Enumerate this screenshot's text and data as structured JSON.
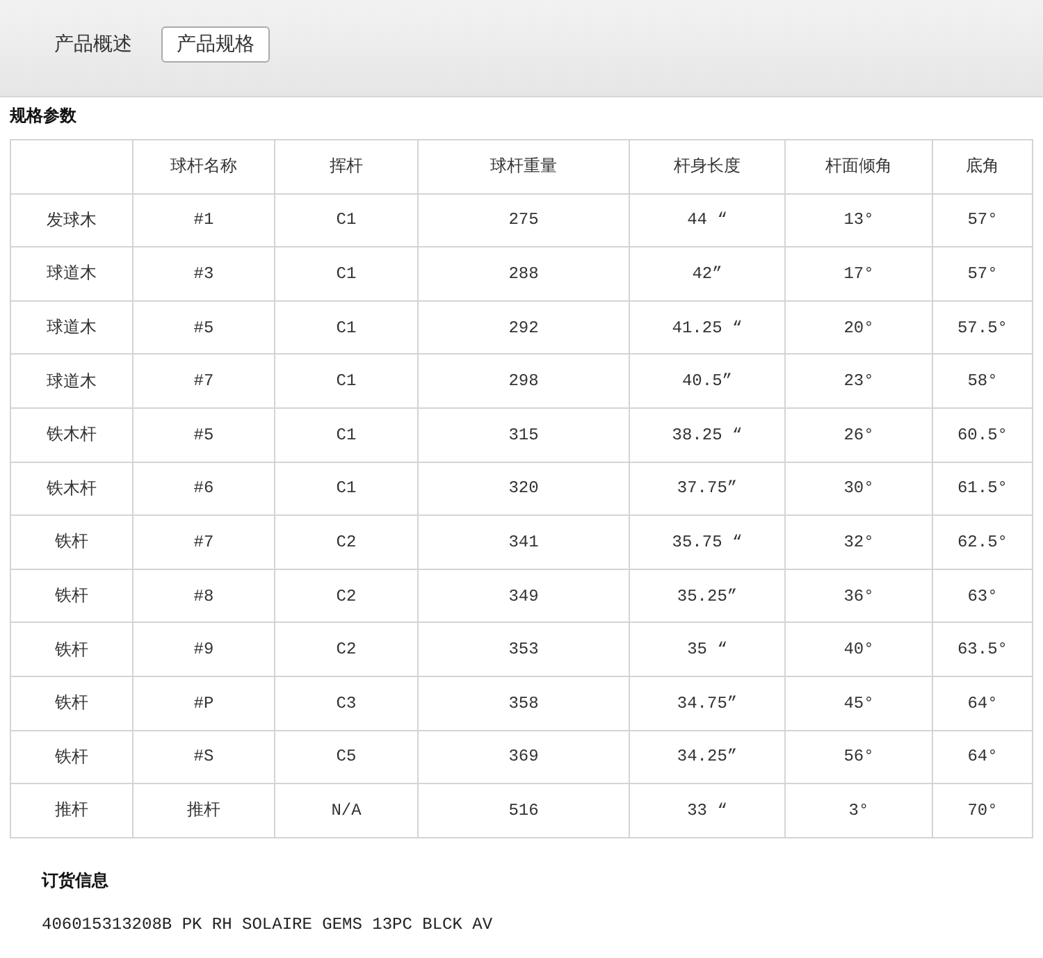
{
  "tabs": [
    {
      "label": "产品概述",
      "selected": false
    },
    {
      "label": "产品规格",
      "selected": true
    }
  ],
  "spec_section": {
    "title": "规格参数",
    "table": {
      "columns": [
        "",
        "球杆名称",
        "挥杆",
        "球杆重量",
        "杆身长度",
        "杆面倾角",
        "底角"
      ],
      "rows": [
        [
          "发球木",
          "#1",
          "C1",
          "275",
          "44 “",
          "13°",
          "57°"
        ],
        [
          "球道木",
          "#3",
          "C1",
          "288",
          "42”",
          "17°",
          "57°"
        ],
        [
          "球道木",
          "#5",
          "C1",
          "292",
          "41.25 “",
          "20°",
          "57.5°"
        ],
        [
          "球道木",
          "#7",
          "C1",
          "298",
          "40.5”",
          "23°",
          "58°"
        ],
        [
          "铁木杆",
          "#5",
          "C1",
          "315",
          "38.25 “",
          "26°",
          "60.5°"
        ],
        [
          "铁木杆",
          "#6",
          "C1",
          "320",
          "37.75”",
          "30°",
          "61.5°"
        ],
        [
          "铁杆",
          "#7",
          "C2",
          "341",
          "35.75 “",
          "32°",
          "62.5°"
        ],
        [
          "铁杆",
          "#8",
          "C2",
          "349",
          "35.25”",
          "36°",
          "63°"
        ],
        [
          "铁杆",
          "#9",
          "C2",
          "353",
          "35 “",
          "40°",
          "63.5°"
        ],
        [
          "铁杆",
          "#P",
          "C3",
          "358",
          "34.75”",
          "45°",
          "64°"
        ],
        [
          "铁杆",
          "#S",
          "C5",
          "369",
          "34.25”",
          "56°",
          "64°"
        ],
        [
          "推杆",
          "推杆",
          "N/A",
          "516",
          "33 “",
          "3°",
          "70°"
        ]
      ]
    }
  },
  "order_section": {
    "title": "订货信息",
    "code": "406015313208B PK RH SOLAIRE GEMS 13PC BLCK AV"
  }
}
